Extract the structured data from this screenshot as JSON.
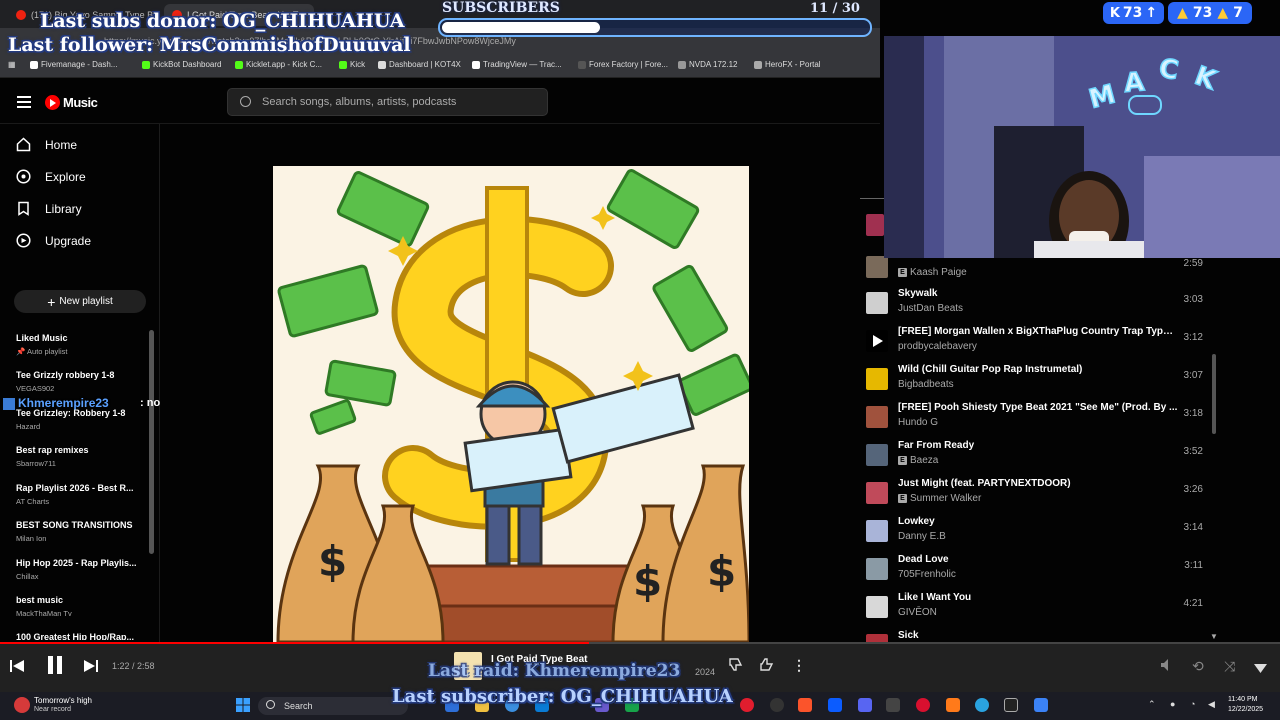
{
  "browser": {
    "tabs": [
      {
        "label": "(171) Big Yavo Sample Type Be"
      },
      {
        "label": "I Got Paid Type Beat - YouT"
      }
    ],
    "url": "https://music.youtube.com/watch?v=97lhagMc8lk&PRAMPLPLh9OtC-YlrAjfPi7FbwJwbNPow8WjceJMy",
    "bookmarks": [
      "Fivemanage - Dash...",
      "KickBot Dashboard",
      "Kicklet.app - Kick C...",
      "Kick",
      "Dashboard | KOT4X",
      "TradingView — Trac...",
      "Forex Factory | Fore...",
      "NVDA 172.12",
      "HeroFX - Portal"
    ]
  },
  "ytm": {
    "logo": "Music",
    "search_placeholder": "Search songs, albums, artists, podcasts"
  },
  "sidebar": {
    "nav": [
      {
        "label": "Home"
      },
      {
        "label": "Explore"
      },
      {
        "label": "Library"
      },
      {
        "label": "Upgrade"
      }
    ],
    "new_playlist": "New playlist",
    "playlists": [
      {
        "title": "Liked Music",
        "sub": "Auto playlist"
      },
      {
        "title": "Tee Grizzly robbery 1-8",
        "sub": "VEGAS902"
      },
      {
        "title": "Tee Grizzley: Robbery 1-8",
        "sub": "Hazard"
      },
      {
        "title": "Best rap remixes",
        "sub": "Sbarrow711"
      },
      {
        "title": "Rap Playlist 2026 - Best R...",
        "sub": "AT Charts"
      },
      {
        "title": "BEST SONG TRANSITIONS",
        "sub": "Milan Ion"
      },
      {
        "title": "Hip Hop 2025 - Rap Playlis...",
        "sub": "Chillax"
      },
      {
        "title": "best music",
        "sub": "MackThaMan Tv"
      },
      {
        "title": "100 Greatest Hip Hop/Rap...",
        "sub": ""
      }
    ]
  },
  "queue": [
    {
      "title": "",
      "artist": "Kaash Paige",
      "explicit": true,
      "duration": "2:59",
      "thumb": "#7a6a5a"
    },
    {
      "title": "Skywalk",
      "artist": "JustDan Beats",
      "explicit": false,
      "duration": "3:03",
      "thumb": "#cfcfcf"
    },
    {
      "title": "[FREE] Morgan Wallen x BigXThaPlug Country Trap Type ...",
      "artist": "prodbycalebavery",
      "explicit": false,
      "duration": "3:12",
      "thumb": "#000000",
      "playing": true
    },
    {
      "title": "Wild (Chill Guitar Pop Rap Instrumetal)",
      "artist": "Bigbadbeats",
      "explicit": false,
      "duration": "3:07",
      "thumb": "#e6b800"
    },
    {
      "title": "[FREE] Pooh Shiesty Type Beat 2021 \"See Me\" (Prod. By ...",
      "artist": "Hundo G",
      "explicit": false,
      "duration": "3:18",
      "thumb": "#a0523d"
    },
    {
      "title": "Far From Ready",
      "artist": "Baeza",
      "explicit": true,
      "duration": "3:52",
      "thumb": "#55657a"
    },
    {
      "title": "Just Might (feat. PARTYNEXTDOOR)",
      "artist": "Summer Walker",
      "explicit": true,
      "duration": "3:26",
      "thumb": "#c04a5a"
    },
    {
      "title": "Lowkey",
      "artist": "Danny E.B",
      "explicit": false,
      "duration": "3:14",
      "thumb": "#a9b4d8"
    },
    {
      "title": "Dead Love",
      "artist": "705Frenholic",
      "explicit": false,
      "duration": "3:11",
      "thumb": "#8a9aa5"
    },
    {
      "title": "Like I Want You",
      "artist": "GIVĒON",
      "explicit": false,
      "duration": "4:21",
      "thumb": "#d8d8d8"
    },
    {
      "title": "Sick",
      "artist": "",
      "explicit": false,
      "duration": "",
      "thumb": "#b0303a"
    }
  ],
  "player": {
    "time": "1:22 / 2:58",
    "progress": 0.46,
    "title": "I Got Paid Type Beat",
    "subtitle": "2024"
  },
  "overlays": {
    "last_subs_donor": "Last subs donor: OG_CHIHUAHUA",
    "last_follower": "Last follower: MrsCommishofDuuuval",
    "subscribers_label": "SUBSCRIBERS",
    "subscribers_count": "11 / 30",
    "subscribers_progress": 0.37,
    "kick_count": "73",
    "likes_count": "73",
    "likes_extra": "7",
    "chat_user": "Khmerempire23",
    "chat_msg": ": no",
    "last_raid": "Last raid: Khmerempire23",
    "last_subscriber": "Last subscriber: OG_CHIHUAHUA"
  },
  "webcam": {
    "sign": "M A C K"
  },
  "taskbar": {
    "weather_title": "Tomorrow's high",
    "weather_sub": "Near record",
    "search": "Search",
    "time": "11:40 PM",
    "date": "12/22/2025"
  },
  "colors": {
    "accent": "#ff0000",
    "overlay_blue": "#2b66f6",
    "bar_bg": "#212121"
  }
}
